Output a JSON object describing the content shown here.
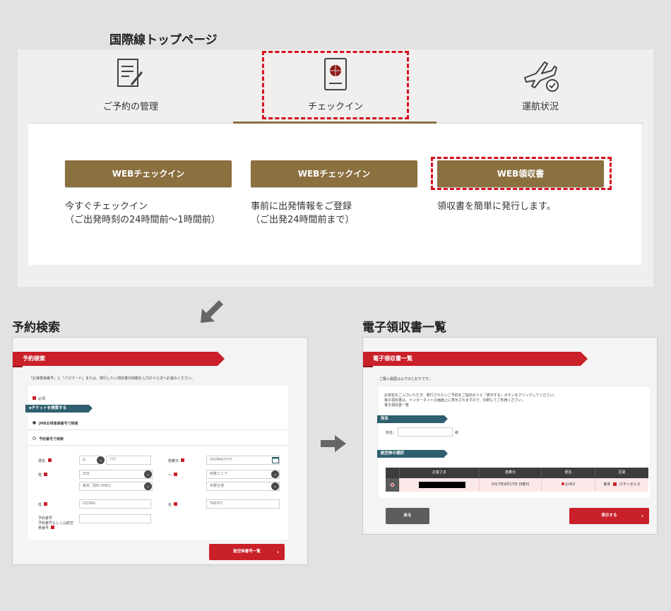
{
  "titles": {
    "top_page": "国際線トップページ",
    "reservation_search": "予約検索",
    "receipt_list": "電子領収書一覧"
  },
  "top_page": {
    "tabs": [
      {
        "label": "ご予約の管理",
        "icon": "document-edit-icon"
      },
      {
        "label": "チェックイン",
        "icon": "passport-icon"
      },
      {
        "label": "運航状況",
        "icon": "airplane-check-icon"
      }
    ],
    "buttons": [
      {
        "label": "WEBチェックイン",
        "desc_line1": "今すぐチェックイン",
        "desc_line2": "（ご出発時刻の24時間前～1時間前）"
      },
      {
        "label": "WEBチェックイン",
        "desc_line1": "事前に出発情報をご登録",
        "desc_line2": "（ご出発24時間前まで）"
      },
      {
        "label": "WEB領収書",
        "desc_line1": "領収書を簡単に発行します。",
        "desc_line2": ""
      }
    ],
    "colors": {
      "gold": "#8b7040",
      "highlight": "#d60f1d"
    }
  },
  "search_screen": {
    "ribbon": "予約検索",
    "intro": "「お得意様番号」と「パスワード」または、発行したい領収書の情報を入力のうえ次へお進みください。",
    "required_note": "必須",
    "section_tag": "eチケットを検索する",
    "radio_jmb": "JMBお得意様番号で検索",
    "radio_reservation": "予約番号で検索",
    "labels": {
      "flight": "便名",
      "boarding_date": "搭乗日",
      "from": "発",
      "to": "へ",
      "last_name": "姓",
      "first_name": "名",
      "reservation_no": "予約番号",
      "reservation_no_2": "予約番号もしくは航空",
      "reservation_no_3": "券番号"
    },
    "fields": {
      "airline": "JL",
      "flight_no": "777",
      "date": "DD/MM/YYYY",
      "from_country": "日本",
      "from_airport": "東京, 羽田 (HND)",
      "to_area": "到着エリア",
      "to_airport": "到着空港",
      "last_name": "OZORA",
      "first_name": "TABITO"
    },
    "submit": "航空券番号一覧"
  },
  "receipt_screen": {
    "ribbon": "電子領収書一覧",
    "history_note": "ご購入履歴は以下のとおりです。",
    "instructions_1": "お宛名をご入力いただき、発行されたいご予約をご指定のうえ「表示する」ボタンをクリックしてください。",
    "instructions_2": "電子領収書は、インターネットの画面上に表示されますので、印刷してご利用ください。",
    "instructions_3": "電子領収書一覧",
    "tag_addressee": "宛名",
    "addressee_label": "宛名：",
    "addressee_suffix": "様",
    "tag_ticket": "航空券の選択",
    "table_headers": [
      "お客さま",
      "搭乗日",
      "便名",
      "区間"
    ],
    "row": {
      "date": "2017年9月17日 日曜日",
      "flight": "JL062",
      "from": "東京",
      "to": "ロサンゼルス"
    },
    "back": "戻る",
    "show": "表示する"
  }
}
